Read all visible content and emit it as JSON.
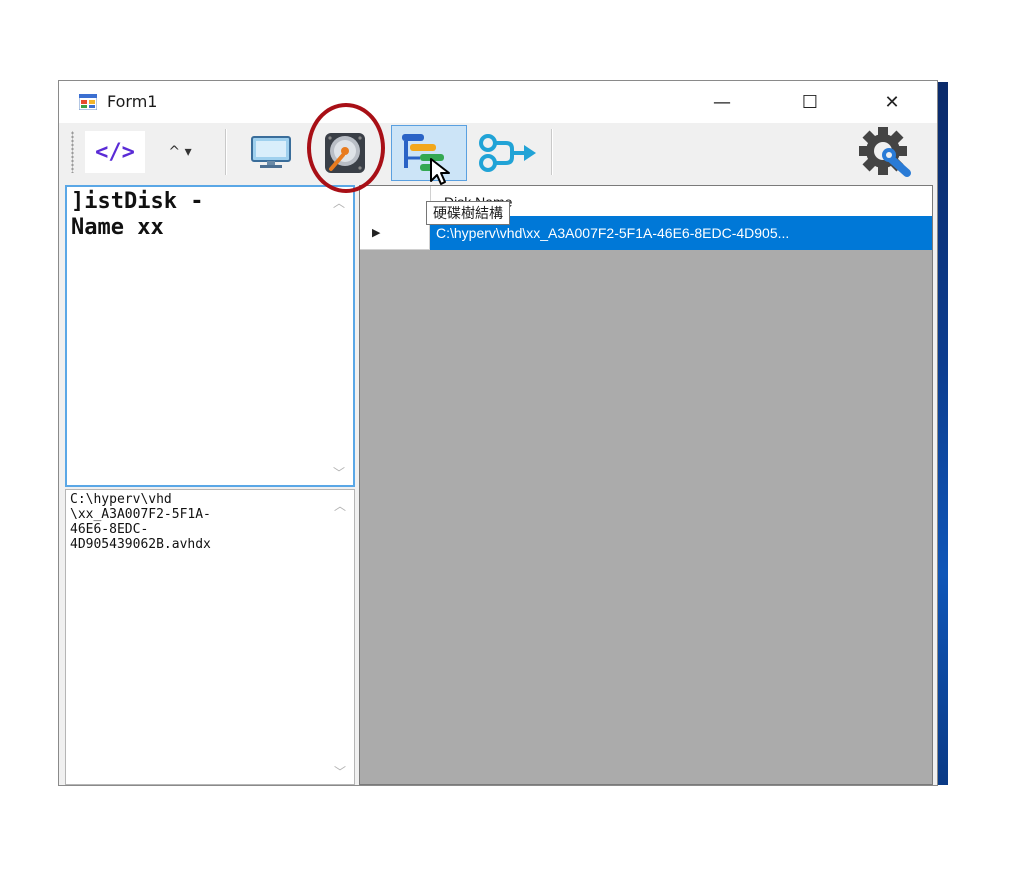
{
  "window": {
    "title": "Form1",
    "minimize_glyph": "—",
    "maximize_glyph": "☐",
    "close_glyph": "✕"
  },
  "toolbar": {
    "code_label": "</>",
    "dropdown_label": "^ ▾",
    "icons": [
      "monitor-icon",
      "hard-disk-icon",
      "tree-structure-icon",
      "share-export-icon",
      "settings-wrench-icon"
    ]
  },
  "tooltip": {
    "text": "硬碟樹結構"
  },
  "left_top": {
    "text": "]istDisk -\nName xx"
  },
  "left_bottom": {
    "lines": [
      "C:\\hyperv\\vhd",
      "\\xx_A3A007F2-5F1A-",
      "46E6-8EDC-",
      "4D905439062B.avhdx"
    ]
  },
  "grid": {
    "column_header": "Disk Name",
    "row_indicator": "▶",
    "selected_value": "C:\\hyperv\\vhd\\xx_A3A007F2-5F1A-46E6-8EDC-4D905..."
  },
  "colors": {
    "selection": "#0078d7",
    "grid_bg": "#ababab",
    "highlight_ring": "#a80f16",
    "code_accent": "#5a2bd6"
  }
}
